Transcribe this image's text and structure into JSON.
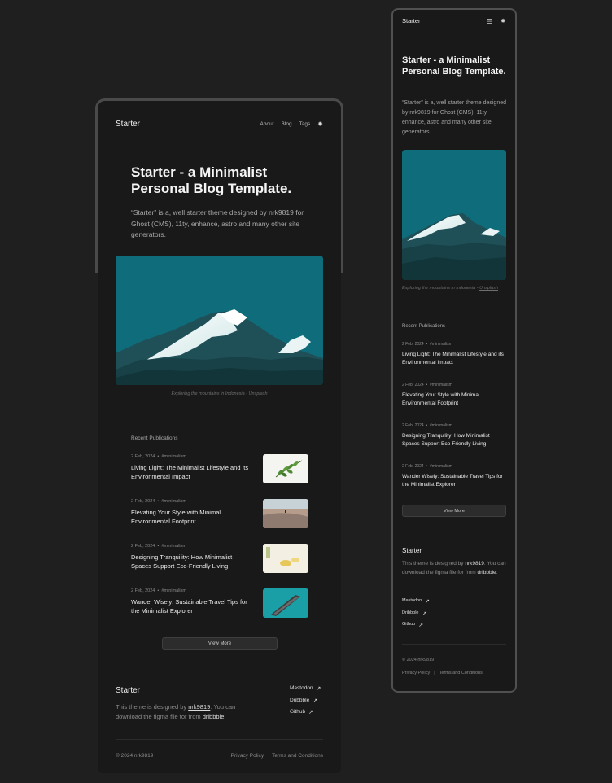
{
  "site": {
    "brand": "Starter",
    "nav": [
      "About",
      "Blog",
      "Tags"
    ],
    "theme_icon": "sun-icon",
    "menu_icon": "hamburger-menu-icon"
  },
  "hero": {
    "title": "Starter - a Minimalist Personal Blog Template.",
    "description": "“Starter” is a, well starter theme designed by nrk9819 for Ghost (CMS), 11ty, enhance, astro and many other site generators."
  },
  "cover": {
    "caption": "Exploring the mountains in Indonesia - ",
    "caption_link": "Unsplash",
    "accent": "#0e6f7e"
  },
  "recent": {
    "heading": "Recent Publications",
    "posts": [
      {
        "date": "2 Feb, 2024",
        "sep": "•",
        "tag": "#minimalism",
        "title": "Living Light: The Minimalist Lifestyle and its Environmental Impact"
      },
      {
        "date": "2 Feb, 2024",
        "sep": "•",
        "tag": "#minimalism",
        "title": "Elevating Your Style with Minimal Environmental Footprint"
      },
      {
        "date": "2 Feb, 2024",
        "sep": "•",
        "tag": "#minimalism",
        "title": "Designing Tranquility: How Minimalist Spaces Support Eco-Friendly Living"
      },
      {
        "date": "2 Feb, 2024",
        "sep": "•",
        "tag": "#minimalism",
        "title": "Wander Wisely: Sustainable Travel Tips for the Minimalist Explorer"
      }
    ],
    "view_more": "View More"
  },
  "footer": {
    "brand": "Starter",
    "desc_before": "This theme is designed by ",
    "author_link": "nrk9819",
    "desc_middle": ". You can download the figma file for from ",
    "dribbble_link": "dribbble",
    "desc_end": ".",
    "social": [
      "Mastodon",
      "Dribbble",
      "Github"
    ],
    "arrow": "↗",
    "copyright": "© 2024 nrk9819",
    "legal": [
      "Privacy Policy",
      "Terms and Conditions"
    ]
  }
}
